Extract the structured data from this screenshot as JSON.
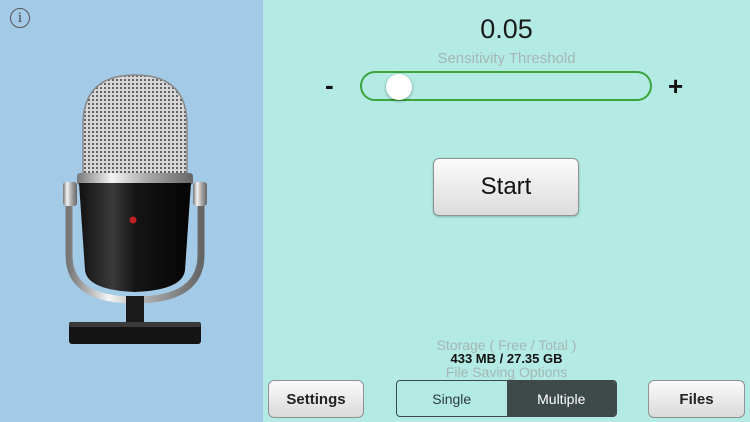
{
  "info": {
    "glyph": "i",
    "icon": "info-icon"
  },
  "threshold": {
    "value_text": "0.05",
    "label": "Sensitivity Threshold",
    "minus": "-",
    "plus": "+",
    "slider_fraction": 0.09
  },
  "start_label": "Start",
  "storage": {
    "label": "Storage ( Free / Total )",
    "value": "433 MB / 27.35 GB"
  },
  "file_saving": {
    "label": "File Saving Options",
    "options": [
      "Single",
      "Multiple"
    ],
    "selected": "Multiple"
  },
  "settings_label": "Settings",
  "files_label": "Files",
  "colors": {
    "left_panel": "#a3cbe8",
    "right_panel": "#b3ebe4",
    "slider_border": "#3ba53b",
    "segment_selected": "#3d4a49"
  }
}
